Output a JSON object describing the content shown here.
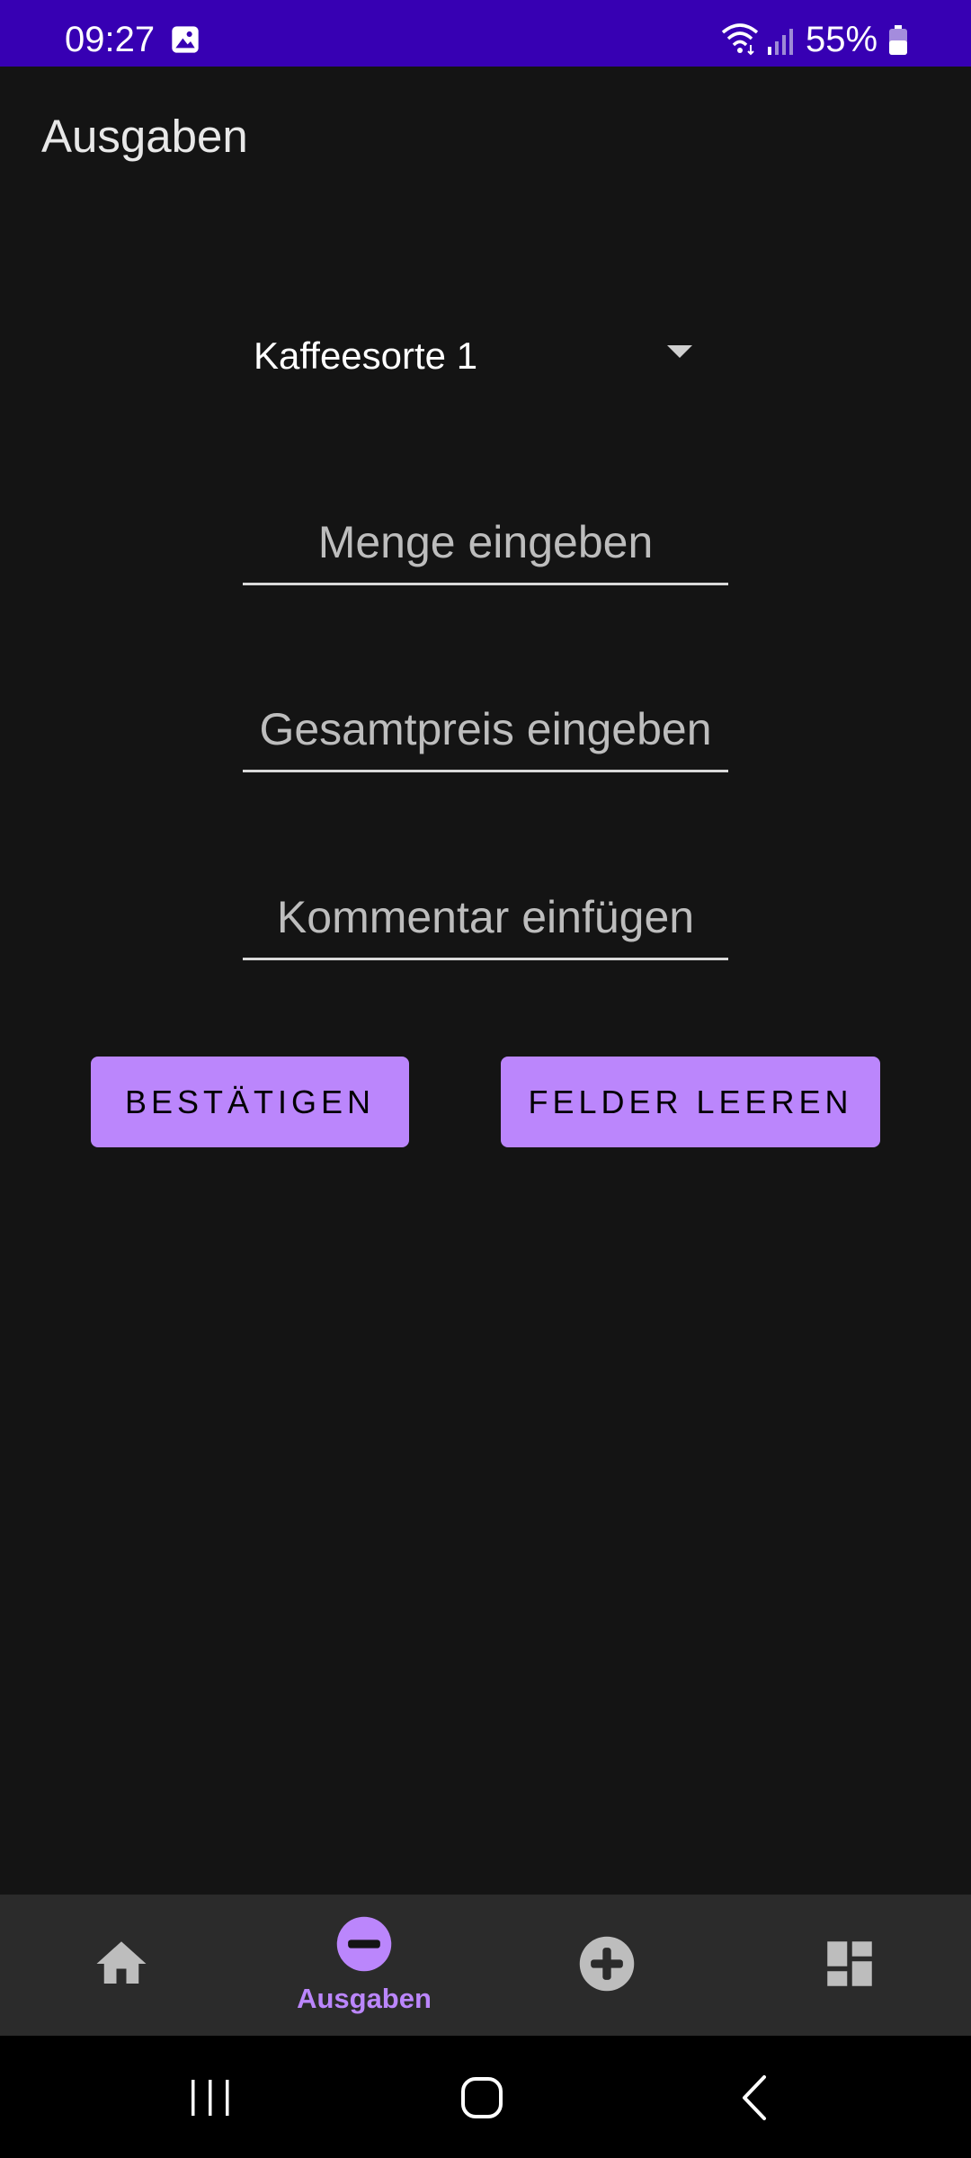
{
  "status_bar": {
    "time": "09:27",
    "battery": "55%",
    "background_color": "#3700b3",
    "icons": [
      "gallery-icon",
      "wifi-icon",
      "signal-icon",
      "battery-icon"
    ]
  },
  "app_bar": {
    "title": "Ausgaben"
  },
  "form": {
    "coffee_type_selected": "Kaffeesorte 1",
    "quantity_placeholder": "Menge eingeben",
    "total_price_placeholder": "Gesamtpreis eingeben",
    "comment_placeholder": "Kommentar einfügen",
    "confirm_label": "BESTÄTIGEN",
    "clear_label": "FELDER LEEREN",
    "button_color": "#bb86fc"
  },
  "bottom_nav": {
    "items": [
      {
        "id": "home",
        "icon": "home-icon",
        "label": "",
        "active": false
      },
      {
        "id": "expenses",
        "icon": "minus-circle-icon",
        "label": "Ausgaben",
        "active": true
      },
      {
        "id": "add",
        "icon": "plus-circle-icon",
        "label": "",
        "active": false
      },
      {
        "id": "dashboard",
        "icon": "dashboard-icon",
        "label": "",
        "active": false
      }
    ],
    "active_color": "#bb86fc",
    "inactive_color": "#bdbdbd"
  },
  "system_nav": {
    "icons": [
      "recents-icon",
      "home-outline-icon",
      "back-icon"
    ]
  }
}
